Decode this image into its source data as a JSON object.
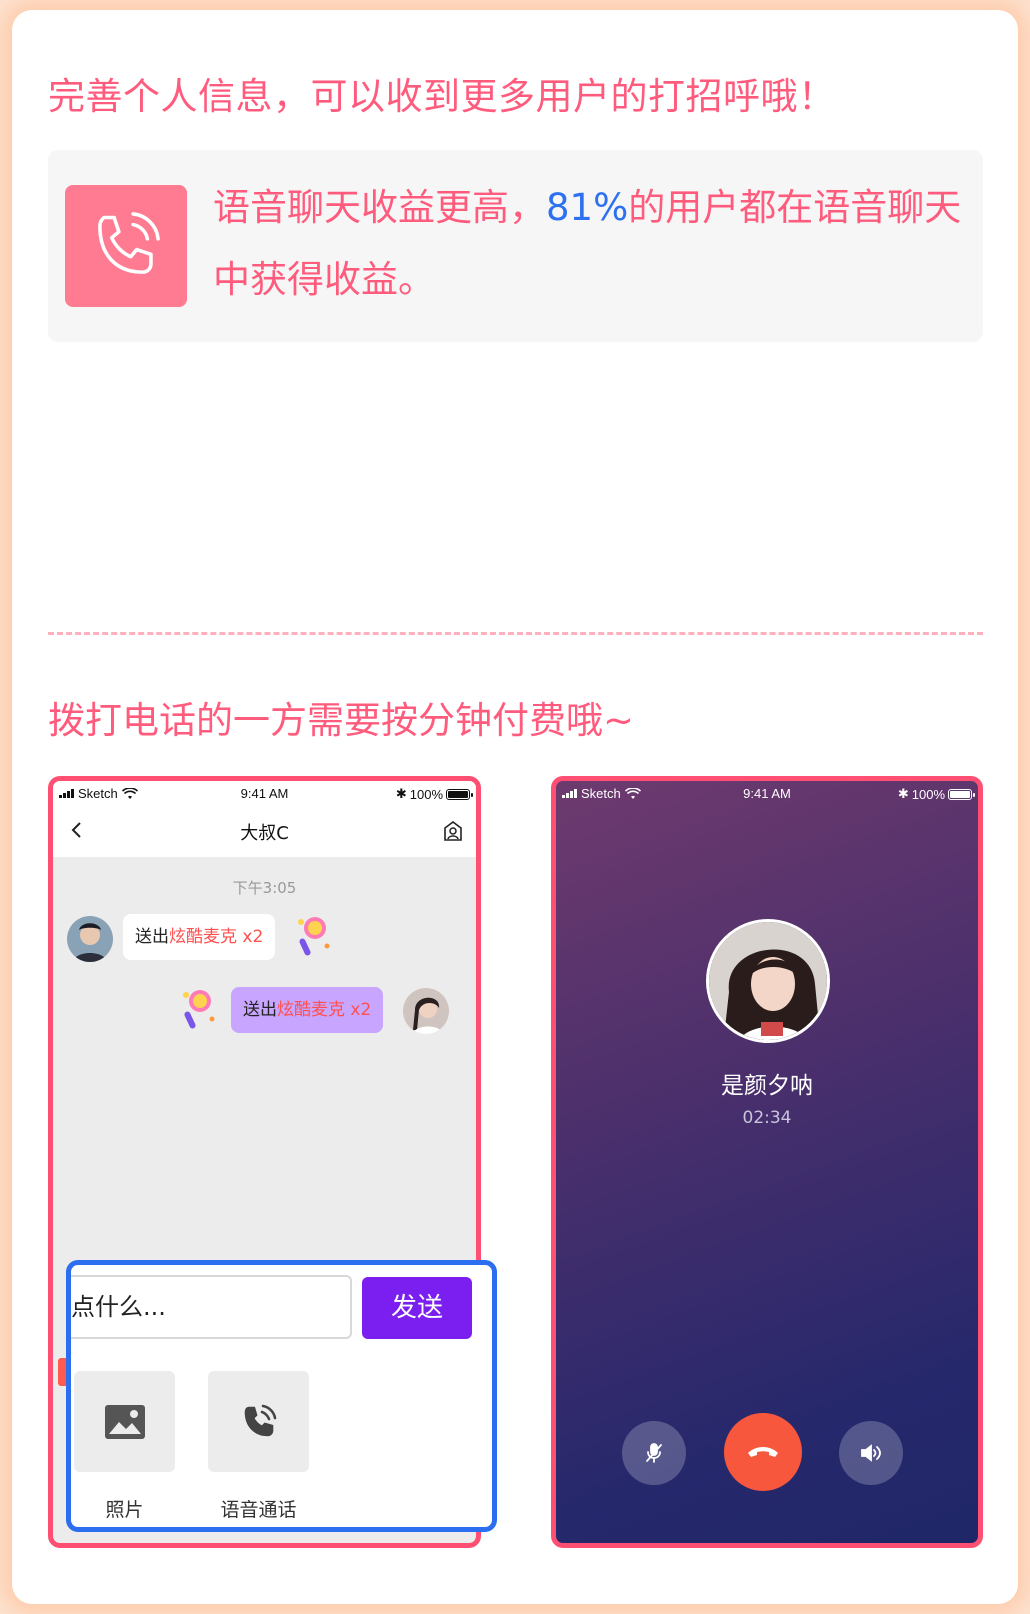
{
  "header": {
    "title": "完善个人信息，可以收到更多用户的打招呼哦！"
  },
  "info": {
    "text_before": "语音聊天收益更高，",
    "percent": "81%",
    "text_after": "的用户都在语音聊天中获得收益。",
    "icon": "phone-call-icon"
  },
  "section2": {
    "title": "拨打电话的一方需要按分钟付费哦~"
  },
  "status_bar": {
    "carrier": "Sketch",
    "time": "9:41 AM",
    "battery": "100%"
  },
  "chat": {
    "title": "大叔C",
    "timestamp": "下午3:05",
    "messages": [
      {
        "prefix": "送出",
        "gift": "炫酷麦克",
        "count": "x2"
      },
      {
        "prefix": "送出",
        "gift": "炫酷麦克",
        "count": "x2"
      }
    ],
    "input_placeholder": "点什么...",
    "send_label": "发送",
    "tools": [
      {
        "label": "照片",
        "icon": "photo-icon"
      },
      {
        "label": "语音通话",
        "icon": "voice-call-icon"
      }
    ]
  },
  "call": {
    "name": "是颜夕呐",
    "duration": "02:34"
  },
  "colors": {
    "accent": "#ff5b7d",
    "highlight_blue": "#2d70f0",
    "send_purple": "#7a1ff0",
    "hangup_red": "#f7573c"
  }
}
